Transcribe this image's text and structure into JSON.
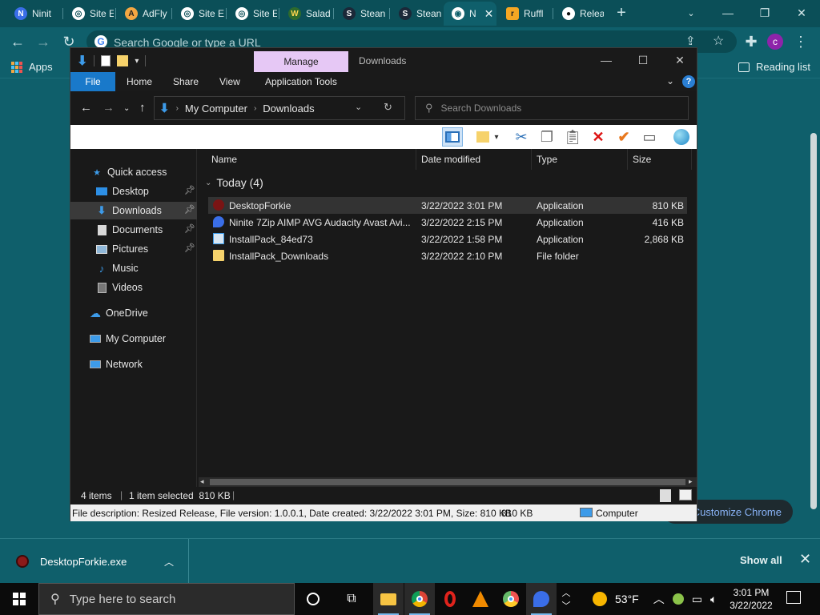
{
  "browser": {
    "tabs": [
      {
        "label": "Ninit",
        "icon": "ninite-icon",
        "active": false
      },
      {
        "label": "Site E",
        "icon": "site-icon",
        "active": false
      },
      {
        "label": "AdFly",
        "icon": "adfly-icon",
        "active": false
      },
      {
        "label": "Site E",
        "icon": "site-icon",
        "active": false
      },
      {
        "label": "Site E",
        "icon": "site-icon",
        "active": false
      },
      {
        "label": "Salad",
        "icon": "salad-icon",
        "active": false
      },
      {
        "label": "Stean",
        "icon": "steam-icon",
        "active": false
      },
      {
        "label": "Stean",
        "icon": "steam-icon",
        "active": false
      },
      {
        "label": "N",
        "icon": "chrome-icon",
        "active": true
      },
      {
        "label": "Ruffl",
        "icon": "ruffle-icon",
        "active": false
      },
      {
        "label": "Relea",
        "icon": "github-icon",
        "active": false
      }
    ],
    "new_tab": "+",
    "omnibox_placeholder": "Search Google or type a URL",
    "avatar_letter": "c",
    "bookmarks": {
      "apps": "Apps",
      "reading_list": "Reading list"
    },
    "customize_label": "Customize Chrome",
    "downloads_bar": {
      "file": "DesktopForkie.exe",
      "show_all": "Show all"
    }
  },
  "explorer": {
    "title": "Downloads",
    "manage_tab": "Manage",
    "ribbon_tabs": [
      "File",
      "Home",
      "Share",
      "View",
      "Application Tools"
    ],
    "address": {
      "root": "My Computer",
      "folder": "Downloads"
    },
    "search_placeholder": "Search Downloads",
    "nav": {
      "quick_access": "Quick access",
      "desktop": "Desktop",
      "downloads": "Downloads",
      "documents": "Documents",
      "pictures": "Pictures",
      "music": "Music",
      "videos": "Videos",
      "onedrive": "OneDrive",
      "my_computer": "My Computer",
      "network": "Network"
    },
    "columns": {
      "name": "Name",
      "date": "Date modified",
      "type": "Type",
      "size": "Size"
    },
    "group_header": "Today (4)",
    "files": [
      {
        "name": "DesktopForkie",
        "date": "3/22/2022 3:01 PM",
        "type": "Application",
        "size": "810 KB",
        "icon": "forkie-icon"
      },
      {
        "name": "Ninite 7Zip AIMP AVG Audacity Avast Avi...",
        "date": "3/22/2022 2:15 PM",
        "type": "Application",
        "size": "416 KB",
        "icon": "ninite-icon"
      },
      {
        "name": "InstallPack_84ed73",
        "date": "3/22/2022 1:58 PM",
        "type": "Application",
        "size": "2,868 KB",
        "icon": "installer-icon"
      },
      {
        "name": "InstallPack_Downloads",
        "date": "3/22/2022 2:10 PM",
        "type": "File folder",
        "size": "",
        "icon": "folder-icon"
      }
    ],
    "status": {
      "items": "4 items",
      "selected": "1 item selected  810 KB"
    },
    "details": {
      "description": "File description: Resized Release, File version: 1.0.0.1, Date created: 3/22/2022 3:01 PM, Size: 810 KB",
      "size": "810 KB",
      "location": "Computer"
    }
  },
  "taskbar": {
    "search_placeholder": "Type here to search",
    "weather": "53°F",
    "time": "3:01 PM",
    "date": "3/22/2022"
  }
}
